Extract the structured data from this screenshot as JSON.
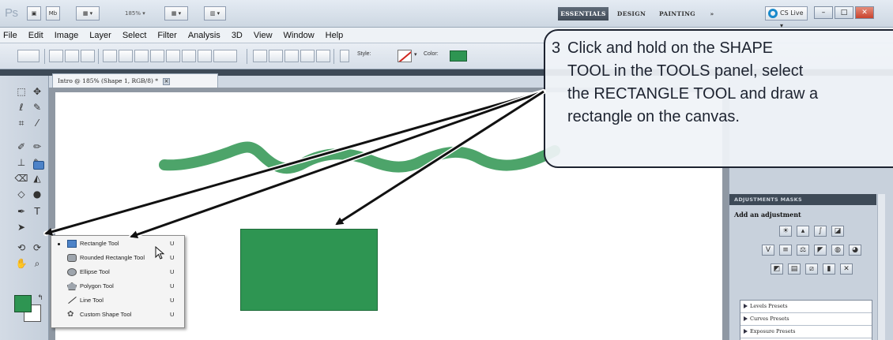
{
  "app": {
    "logo": "Ps",
    "zoom_readout": "185% ▾",
    "workspaces": [
      "ESSENTIALS",
      "DESIGN",
      "PAINTING",
      "»"
    ],
    "cs_live": "CS Live ▾"
  },
  "menu": [
    "File",
    "Edit",
    "Image",
    "Layer",
    "Select",
    "Filter",
    "Analysis",
    "3D",
    "View",
    "Window",
    "Help"
  ],
  "options_bar": {
    "style_label": "Style:",
    "color_label": "Color:",
    "color_value": "#2e9552"
  },
  "document": {
    "tab_title": "Intro @ 185% (Shape 1, RGB/8) *",
    "tab_close": "×",
    "shape_color": "#2e9552"
  },
  "flyout": {
    "items": [
      {
        "label": "Rectangle Tool",
        "key": "U",
        "icon": "rectangle-icon",
        "selected": true
      },
      {
        "label": "Rounded Rectangle Tool",
        "key": "U",
        "icon": "rounded-rectangle-icon",
        "selected": false
      },
      {
        "label": "Ellipse Tool",
        "key": "U",
        "icon": "ellipse-icon",
        "selected": false
      },
      {
        "label": "Polygon Tool",
        "key": "U",
        "icon": "polygon-icon",
        "selected": false
      },
      {
        "label": "Line Tool",
        "key": "U",
        "icon": "line-icon",
        "selected": false
      },
      {
        "label": "Custom Shape Tool",
        "key": "U",
        "icon": "custom-shape-icon",
        "selected": false
      }
    ]
  },
  "right_panel": {
    "tabs": "ADJUSTMENTS    MASKS",
    "heading": "Add an adjustment",
    "presets": [
      "Levels Presets",
      "Curves Presets",
      "Exposure Presets"
    ]
  },
  "callout": {
    "number": "3",
    "line1": "Click and hold on the SHAPE",
    "line2": "TOOL in the TOOLS panel, select",
    "line3": "the RECTANGLE TOOL and draw a",
    "line4": "rectangle  on the canvas."
  },
  "colors": {
    "accent_green": "#2e9552",
    "callout_border": "#1d2330",
    "selected_blue": "#4d83c8"
  }
}
